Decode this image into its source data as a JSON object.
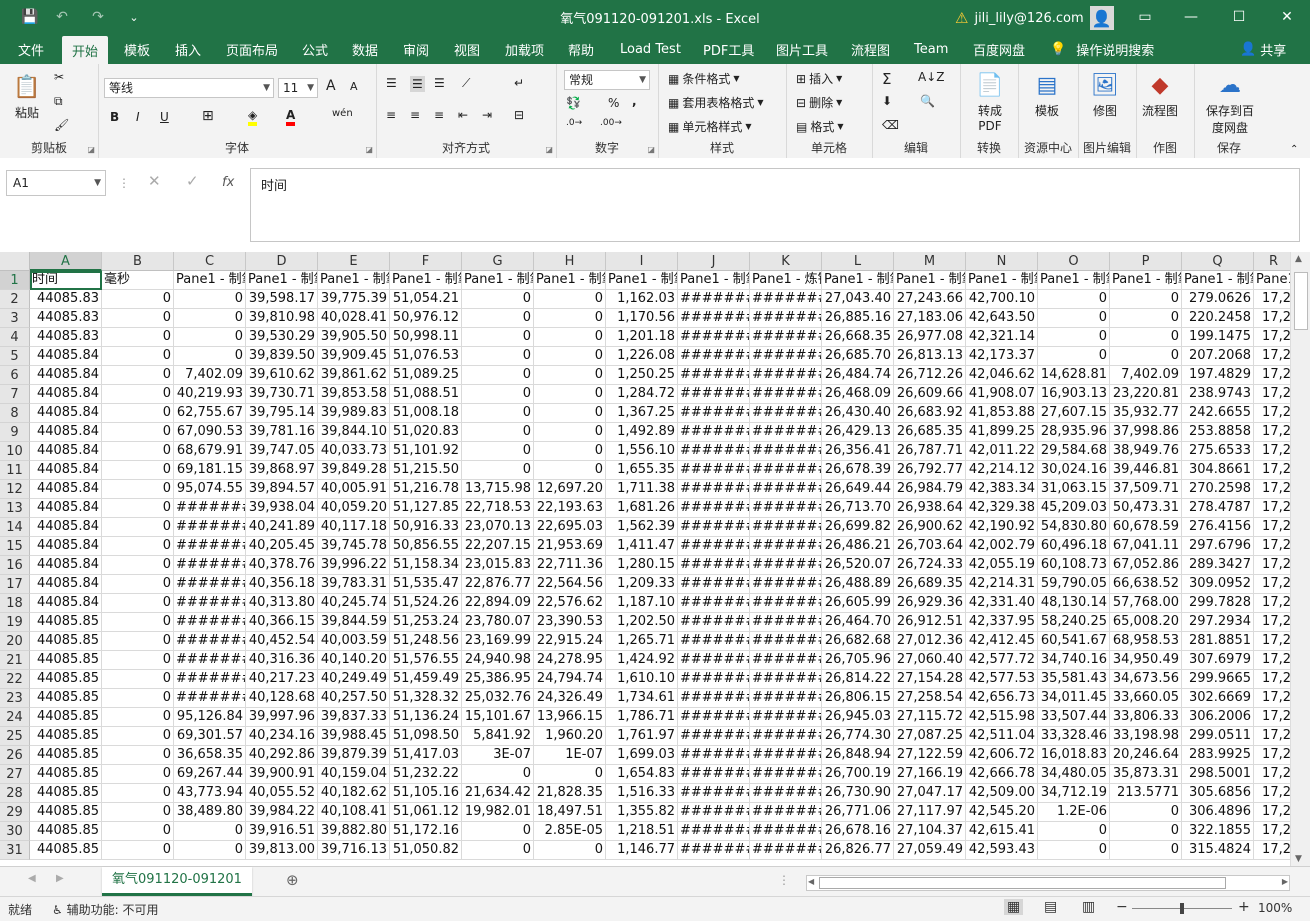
{
  "titlebar": {
    "title": "氧气091120-091201.xls  -  Excel",
    "user": "jili_lily@126.com",
    "qat": {
      "save": "💾",
      "undo": "↶",
      "redo": "↷",
      "customize": "⌄"
    }
  },
  "tabs": [
    "文件",
    "开始",
    "模板",
    "插入",
    "页面布局",
    "公式",
    "数据",
    "审阅",
    "视图",
    "加载项",
    "帮助",
    "Load Test",
    "PDF工具",
    "图片工具",
    "流程图",
    "Team",
    "百度网盘"
  ],
  "tell_me": "操作说明搜索",
  "share": "共享",
  "ribbon": {
    "clipboard": {
      "label": "剪贴板",
      "paste": "粘贴"
    },
    "font": {
      "label": "字体",
      "name": "等线",
      "size": "11",
      "bold": "B",
      "italic": "I",
      "underline": "U",
      "grow": "A",
      "shrink": "A",
      "wen": "wén",
      "highlight_color": "#ffff00",
      "font_color": "#ff0000"
    },
    "alignment": {
      "label": "对齐方式"
    },
    "number": {
      "label": "数字",
      "format": "常规",
      "percent": "%",
      "comma": ","
    },
    "styles": {
      "label": "样式",
      "conditional": "条件格式",
      "table": "套用表格格式",
      "cell": "单元格样式"
    },
    "cells": {
      "label": "单元格",
      "insert": "插入",
      "delete": "删除",
      "format": "格式"
    },
    "editing": {
      "label": "编辑",
      "sum": "Σ"
    },
    "convert": {
      "label": "转换",
      "btn": "转成PDF"
    },
    "resource": {
      "label": "资源中心",
      "btn": "模板"
    },
    "imgedit": {
      "label": "图片编辑",
      "btn": "修图"
    },
    "draw": {
      "label": "作图",
      "btn": "流程图"
    },
    "save": {
      "label": "保存",
      "btn": "保存到百度网盘"
    }
  },
  "formula_bar": {
    "name_box": "A1",
    "content": "时间",
    "fx": "fx"
  },
  "grid": {
    "columns": [
      "A",
      "B",
      "C",
      "D",
      "E",
      "F",
      "G",
      "H",
      "I",
      "J",
      "K",
      "L",
      "M",
      "N",
      "O",
      "P",
      "Q",
      "R"
    ],
    "header_row": [
      "时间",
      "毫秒",
      "Pane1 - 制氧",
      "Pane1 - 制氧",
      "Pane1 - 制氧",
      "Pane1 - 制氧",
      "Pane1 - 制氧",
      "Pane1 - 制氧",
      "Pane1 - 制氧",
      "Pane1 - 制氧",
      "Pane1 - 炼钢",
      "Pane1 - 制氧",
      "Pane1 - 制氧",
      "Pane1 - 制氧",
      "Pane1 - 制氧",
      "Pane1 - 制氧",
      "Pane1 - 制氧",
      "Pane1"
    ],
    "rows": [
      [
        "44085.83",
        "0",
        "0",
        "39,598.17",
        "39,775.39",
        "51,054.21",
        "0",
        "0",
        "1,162.03",
        "#######",
        "#######",
        "27,043.40",
        "27,243.66",
        "42,700.10",
        "0",
        "0",
        "279.0626",
        "17,2"
      ],
      [
        "44085.83",
        "0",
        "0",
        "39,810.98",
        "40,028.41",
        "50,976.12",
        "0",
        "0",
        "1,170.56",
        "#######",
        "#######",
        "26,885.16",
        "27,183.06",
        "42,643.50",
        "0",
        "0",
        "220.2458",
        "17,2"
      ],
      [
        "44085.83",
        "0",
        "0",
        "39,530.29",
        "39,905.50",
        "50,998.11",
        "0",
        "0",
        "1,201.18",
        "#######",
        "#######",
        "26,668.35",
        "26,977.08",
        "42,321.14",
        "0",
        "0",
        "199.1475",
        "17,2"
      ],
      [
        "44085.84",
        "0",
        "0",
        "39,839.50",
        "39,909.45",
        "51,076.53",
        "0",
        "0",
        "1,226.08",
        "#######",
        "#######",
        "26,685.70",
        "26,813.13",
        "42,173.37",
        "0",
        "0",
        "207.2068",
        "17,2"
      ],
      [
        "44085.84",
        "0",
        "7,402.09",
        "39,610.62",
        "39,861.62",
        "51,089.25",
        "0",
        "0",
        "1,250.25",
        "#######",
        "#######",
        "26,484.74",
        "26,712.26",
        "42,046.62",
        "14,628.81",
        "7,402.09",
        "197.4829",
        "17,2"
      ],
      [
        "44085.84",
        "0",
        "40,219.93",
        "39,730.71",
        "39,853.58",
        "51,088.51",
        "0",
        "0",
        "1,284.72",
        "#######",
        "#######",
        "26,468.09",
        "26,609.66",
        "41,908.07",
        "16,903.13",
        "23,220.81",
        "238.9743",
        "17,2"
      ],
      [
        "44085.84",
        "0",
        "62,755.67",
        "39,795.14",
        "39,989.83",
        "51,008.18",
        "0",
        "0",
        "1,367.25",
        "#######",
        "#######",
        "26,430.40",
        "26,683.92",
        "41,853.88",
        "27,607.15",
        "35,932.77",
        "242.6655",
        "17,2"
      ],
      [
        "44085.84",
        "0",
        "67,090.53",
        "39,781.16",
        "39,844.10",
        "51,020.83",
        "0",
        "0",
        "1,492.89",
        "#######",
        "#######",
        "26,429.13",
        "26,685.35",
        "41,899.25",
        "28,935.96",
        "37,998.86",
        "253.8858",
        "17,2"
      ],
      [
        "44085.84",
        "0",
        "68,679.91",
        "39,747.05",
        "40,033.73",
        "51,101.92",
        "0",
        "0",
        "1,556.10",
        "#######",
        "#######",
        "26,356.41",
        "26,787.71",
        "42,011.22",
        "29,584.68",
        "38,949.76",
        "275.6533",
        "17,2"
      ],
      [
        "44085.84",
        "0",
        "69,181.15",
        "39,868.97",
        "39,849.28",
        "51,215.50",
        "0",
        "0",
        "1,655.35",
        "#######",
        "#######",
        "26,678.39",
        "26,792.77",
        "42,214.12",
        "30,024.16",
        "39,446.81",
        "304.8661",
        "17,2"
      ],
      [
        "44085.84",
        "0",
        "95,074.55",
        "39,894.57",
        "40,005.91",
        "51,216.78",
        "13,715.98",
        "12,697.20",
        "1,711.38",
        "#######",
        "#######",
        "26,649.44",
        "26,984.79",
        "42,383.34",
        "31,063.15",
        "37,509.71",
        "270.2598",
        "17,2"
      ],
      [
        "44085.84",
        "0",
        "#######",
        "39,938.04",
        "40,059.20",
        "51,127.85",
        "22,718.53",
        "22,193.63",
        "1,681.26",
        "#######",
        "#######",
        "26,713.70",
        "26,938.64",
        "42,329.38",
        "45,209.03",
        "50,473.31",
        "278.4787",
        "17,2"
      ],
      [
        "44085.84",
        "0",
        "#######",
        "40,241.89",
        "40,117.18",
        "50,916.33",
        "23,070.13",
        "22,695.03",
        "1,562.39",
        "#######",
        "#######",
        "26,699.82",
        "26,900.62",
        "42,190.92",
        "54,830.80",
        "60,678.59",
        "276.4156",
        "17,2"
      ],
      [
        "44085.84",
        "0",
        "#######",
        "40,205.45",
        "39,745.78",
        "50,856.55",
        "22,207.15",
        "21,953.69",
        "1,411.47",
        "#######",
        "#######",
        "26,486.21",
        "26,703.64",
        "42,002.79",
        "60,496.18",
        "67,041.11",
        "297.6796",
        "17,2"
      ],
      [
        "44085.84",
        "0",
        "#######",
        "40,378.76",
        "39,996.22",
        "51,158.34",
        "23,015.83",
        "22,711.36",
        "1,280.15",
        "#######",
        "#######",
        "26,520.07",
        "26,724.33",
        "42,055.19",
        "60,108.73",
        "67,052.86",
        "289.3427",
        "17,2"
      ],
      [
        "44085.84",
        "0",
        "#######",
        "40,356.18",
        "39,783.31",
        "51,535.47",
        "22,876.77",
        "22,564.56",
        "1,209.33",
        "#######",
        "#######",
        "26,488.89",
        "26,689.35",
        "42,214.31",
        "59,790.05",
        "66,638.52",
        "309.0952",
        "17,2"
      ],
      [
        "44085.84",
        "0",
        "#######",
        "40,313.80",
        "40,245.74",
        "51,524.26",
        "22,894.09",
        "22,576.62",
        "1,187.10",
        "#######",
        "#######",
        "26,605.99",
        "26,929.36",
        "42,331.40",
        "48,130.14",
        "57,768.00",
        "299.7828",
        "17,2"
      ],
      [
        "44085.85",
        "0",
        "#######",
        "40,366.15",
        "39,844.59",
        "51,253.24",
        "23,780.07",
        "23,390.53",
        "1,202.50",
        "#######",
        "#######",
        "26,464.70",
        "26,912.51",
        "42,337.95",
        "58,240.25",
        "65,008.20",
        "297.2934",
        "17,2"
      ],
      [
        "44085.85",
        "0",
        "#######",
        "40,452.54",
        "40,003.59",
        "51,248.56",
        "23,169.99",
        "22,915.24",
        "1,265.71",
        "#######",
        "#######",
        "26,682.68",
        "27,012.36",
        "42,412.45",
        "60,541.67",
        "68,958.53",
        "281.8851",
        "17,2"
      ],
      [
        "44085.85",
        "0",
        "#######",
        "40,316.36",
        "40,140.20",
        "51,576.55",
        "24,940.98",
        "24,278.95",
        "1,424.92",
        "#######",
        "#######",
        "26,705.96",
        "27,060.40",
        "42,577.72",
        "34,740.16",
        "34,950.49",
        "307.6979",
        "17,2"
      ],
      [
        "44085.85",
        "0",
        "#######",
        "40,217.23",
        "40,249.49",
        "51,459.49",
        "25,386.95",
        "24,794.74",
        "1,610.10",
        "#######",
        "#######",
        "26,814.22",
        "27,154.28",
        "42,577.53",
        "35,581.43",
        "34,673.56",
        "299.9665",
        "17,2"
      ],
      [
        "44085.85",
        "0",
        "#######",
        "40,128.68",
        "40,257.50",
        "51,328.32",
        "25,032.76",
        "24,326.49",
        "1,734.61",
        "#######",
        "#######",
        "26,806.15",
        "27,258.54",
        "42,656.73",
        "34,011.45",
        "33,660.05",
        "302.6669",
        "17,2"
      ],
      [
        "44085.85",
        "0",
        "95,126.84",
        "39,997.96",
        "39,837.33",
        "51,136.24",
        "15,101.67",
        "13,966.15",
        "1,786.71",
        "#######",
        "#######",
        "26,945.03",
        "27,115.72",
        "42,515.98",
        "33,507.44",
        "33,806.33",
        "306.2006",
        "17,2"
      ],
      [
        "44085.85",
        "0",
        "69,301.57",
        "40,234.16",
        "39,988.45",
        "51,098.50",
        "5,841.92",
        "1,960.20",
        "1,761.97",
        "#######",
        "#######",
        "26,774.30",
        "27,087.25",
        "42,511.04",
        "33,328.46",
        "33,198.98",
        "299.0511",
        "17,2"
      ],
      [
        "44085.85",
        "0",
        "36,658.35",
        "40,292.86",
        "39,879.39",
        "51,417.03",
        "3E-07",
        "1E-07",
        "1,699.03",
        "#######",
        "#######",
        "26,848.94",
        "27,122.59",
        "42,606.72",
        "16,018.83",
        "20,246.64",
        "283.9925",
        "17,2"
      ],
      [
        "44085.85",
        "0",
        "69,267.44",
        "39,900.91",
        "40,159.04",
        "51,232.22",
        "0",
        "0",
        "1,654.83",
        "#######",
        "#######",
        "26,700.19",
        "27,166.19",
        "42,666.78",
        "34,480.05",
        "35,873.31",
        "298.5001",
        "17,2"
      ],
      [
        "44085.85",
        "0",
        "43,773.94",
        "40,055.52",
        "40,182.62",
        "51,105.16",
        "21,634.42",
        "21,828.35",
        "1,516.33",
        "#######",
        "#######",
        "26,730.90",
        "27,047.17",
        "42,509.00",
        "34,712.19",
        "213.5771",
        "305.6856",
        "17,2"
      ],
      [
        "44085.85",
        "0",
        "38,489.80",
        "39,984.22",
        "40,108.41",
        "51,061.12",
        "19,982.01",
        "18,497.51",
        "1,355.82",
        "#######",
        "#######",
        "26,771.06",
        "27,117.97",
        "42,545.20",
        "1.2E-06",
        "0",
        "306.4896",
        "17,2"
      ],
      [
        "44085.85",
        "0",
        "0",
        "39,916.51",
        "39,882.80",
        "51,172.16",
        "0",
        "2.85E-05",
        "1,218.51",
        "#######",
        "#######",
        "26,678.16",
        "27,104.37",
        "42,615.41",
        "0",
        "0",
        "322.1855",
        "17,2"
      ],
      [
        "44085.85",
        "0",
        "0",
        "39,813.00",
        "39,716.13",
        "51,050.82",
        "0",
        "0",
        "1,146.77",
        "#######",
        "#######",
        "26,826.77",
        "27,059.49",
        "42,593.43",
        "0",
        "0",
        "315.4824",
        "17,2"
      ]
    ]
  },
  "sheet_tab": "氧气091120-091201",
  "status": {
    "ready": "就绪",
    "accessibility": "辅助功能: 不可用",
    "zoom": "100%"
  }
}
